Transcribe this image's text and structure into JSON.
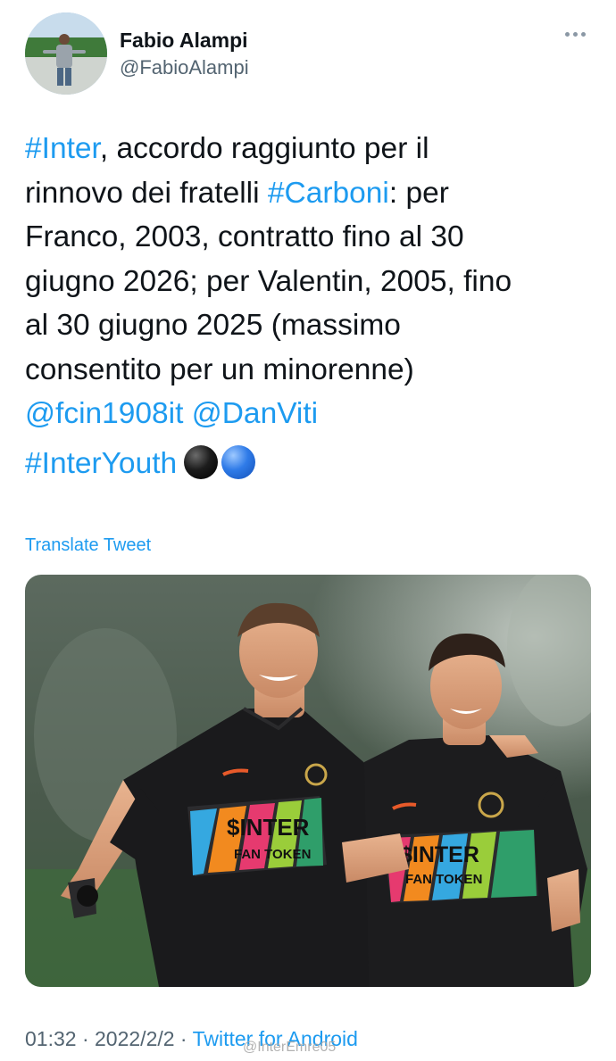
{
  "tweet": {
    "author": {
      "display_name": "Fabio Alampi",
      "handle": "@FabioAlampi"
    },
    "text": {
      "line1_link": "#Inter",
      "line1_rest": ", accordo raggiunto per il",
      "line2_start": "rinnovo dei fratelli ",
      "line2_link": "#Carboni",
      "line2_rest": ": per",
      "line3": "Franco, 2003, contratto fino al 30",
      "line4": "giugno 2026; per Valentin, 2005, fino",
      "line5": "al 30 giugno 2025 (massimo",
      "line6": "consentito per un minorenne)",
      "mention1": "@fcin1908it",
      "mention2": "@DanViti",
      "hashtag": "#InterYouth"
    },
    "translate_label": "Translate Tweet",
    "media": {
      "sponsor_text": "$INTER",
      "sponsor_sub": "FAN TOKEN"
    },
    "meta": {
      "time": "01:32",
      "separator": " · ",
      "date": "2022/2/2",
      "source": "Twitter for Android"
    },
    "watermark": "@InterEmre05"
  },
  "colors": {
    "link": "#1d9bf0",
    "text": "#0f1419",
    "secondary": "#536471"
  },
  "icons": [
    "more-options-icon",
    "black-circle-emoji",
    "blue-circle-emoji"
  ]
}
